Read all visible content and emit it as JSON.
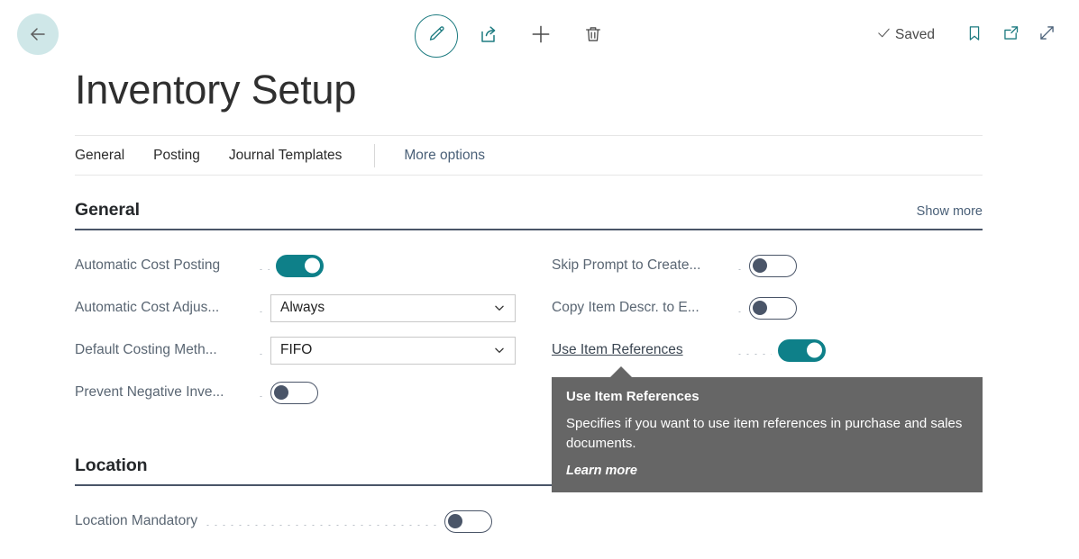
{
  "topbar": {
    "back_label": "Back",
    "back_icon": "arrow-left-icon",
    "center_actions": [
      {
        "name": "edit-button",
        "icon": "pencil-icon",
        "label": "Edit"
      },
      {
        "name": "share-button",
        "icon": "share-icon",
        "label": "Share"
      },
      {
        "name": "new-button",
        "icon": "plus-icon",
        "label": "New"
      },
      {
        "name": "delete-button",
        "icon": "trash-icon",
        "label": "Delete"
      }
    ],
    "status": {
      "icon": "checkmark-icon",
      "label": "Saved"
    },
    "right_actions": [
      {
        "name": "bookmark-button",
        "icon": "bookmark-icon",
        "label": "Bookmark"
      },
      {
        "name": "open-new-button",
        "icon": "open-in-new-icon",
        "label": "Open in new window"
      },
      {
        "name": "fullscreen-button",
        "icon": "expand-arrows-icon",
        "label": "Expand"
      }
    ]
  },
  "page": {
    "title": "Inventory Setup"
  },
  "tabs": {
    "items": [
      {
        "label": "General"
      },
      {
        "label": "Posting"
      },
      {
        "label": "Journal Templates"
      }
    ],
    "more_label": "More options"
  },
  "sections": [
    {
      "title": "General",
      "show_more_label": "Show more",
      "left_fields": [
        {
          "label": "Automatic Cost Posting",
          "control": "toggle",
          "state": "on",
          "leader_dots": 2
        },
        {
          "label": "Automatic Cost Adjus...",
          "control": "select",
          "value": "Always",
          "leader_dots": 1
        },
        {
          "label": "Default Costing Meth...",
          "control": "select",
          "value": "FIFO",
          "leader_dots": 1
        },
        {
          "label": "Prevent Negative Inve...",
          "control": "toggle",
          "state": "off",
          "leader_dots": 1
        }
      ],
      "right_fields": [
        {
          "label": "Skip Prompt to Create...",
          "control": "toggle",
          "state": "off",
          "leader_dots": 1
        },
        {
          "label": "Copy Item Descr. to E...",
          "control": "toggle",
          "state": "off",
          "leader_dots": 1
        },
        {
          "label": "Use Item References",
          "control": "toggle",
          "state": "on",
          "hovered": true,
          "leader_dots": 4
        }
      ]
    },
    {
      "title": "Location",
      "show_more_label": "",
      "left_fields": [
        {
          "label": "Location Mandatory",
          "control": "toggle",
          "state": "off",
          "leader_dots": 24
        }
      ],
      "right_fields": []
    }
  ],
  "tooltip": {
    "title": "Use Item References",
    "body": "Specifies if you want to use item references in purchase and sales documents.",
    "link_label": "Learn more"
  },
  "colors": {
    "accent_teal": "#0e8089",
    "back_circle": "#cfe7e8",
    "label_gray": "#5a6673",
    "section_rule": "#4a5568",
    "tooltip_bg": "#666666",
    "link_slate": "#4a6078"
  }
}
